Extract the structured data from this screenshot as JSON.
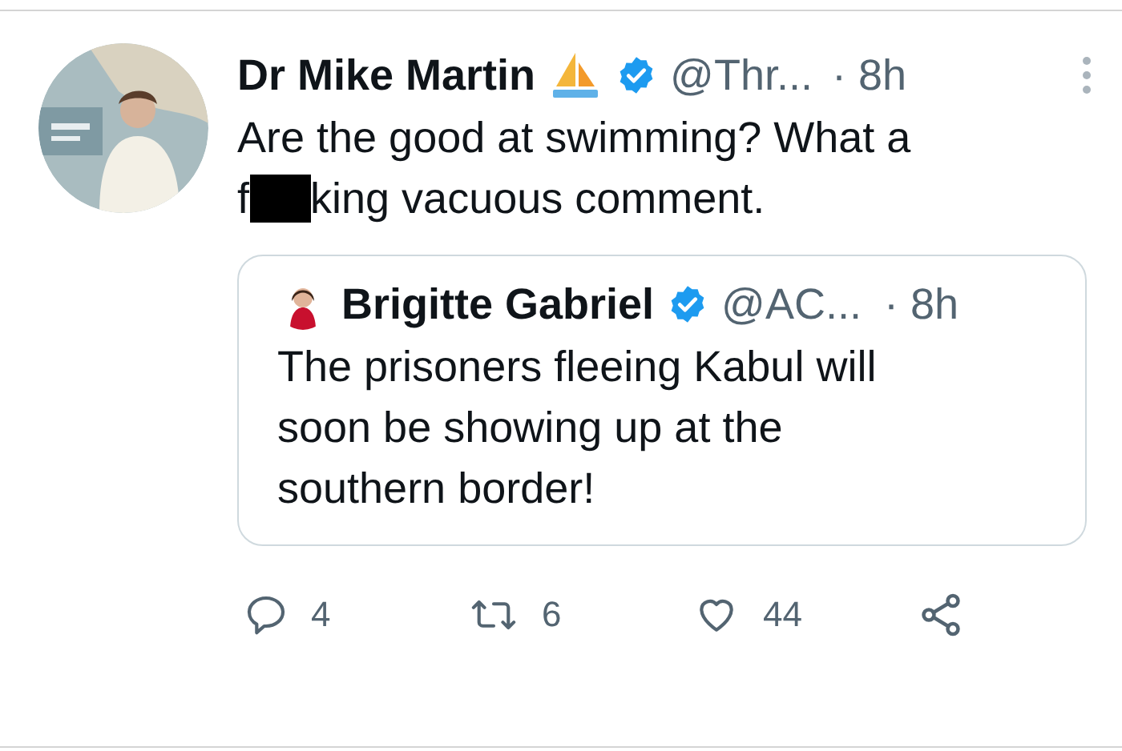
{
  "tweet": {
    "author": {
      "name": "Dr Mike Martin",
      "handle": "@Thr...",
      "time": "· 8h",
      "verified": true
    },
    "text_line_1": "Are the good at swimming? What a",
    "text_line_2_start": "f",
    "text_line_2_end": "king vacuous comment.",
    "redacted": true,
    "quote": {
      "author": {
        "name": "Brigitte Gabriel",
        "handle": "@AC...",
        "time": "· 8h",
        "verified": true
      },
      "lines": [
        "The prisoners fleeing Kabul will",
        "soon be showing up at the",
        "southern border!"
      ]
    },
    "actions": [
      {
        "kind": "reply",
        "count": "4"
      },
      {
        "kind": "retweet",
        "count": "6"
      },
      {
        "kind": "like",
        "count": "44"
      },
      {
        "kind": "share"
      }
    ]
  }
}
